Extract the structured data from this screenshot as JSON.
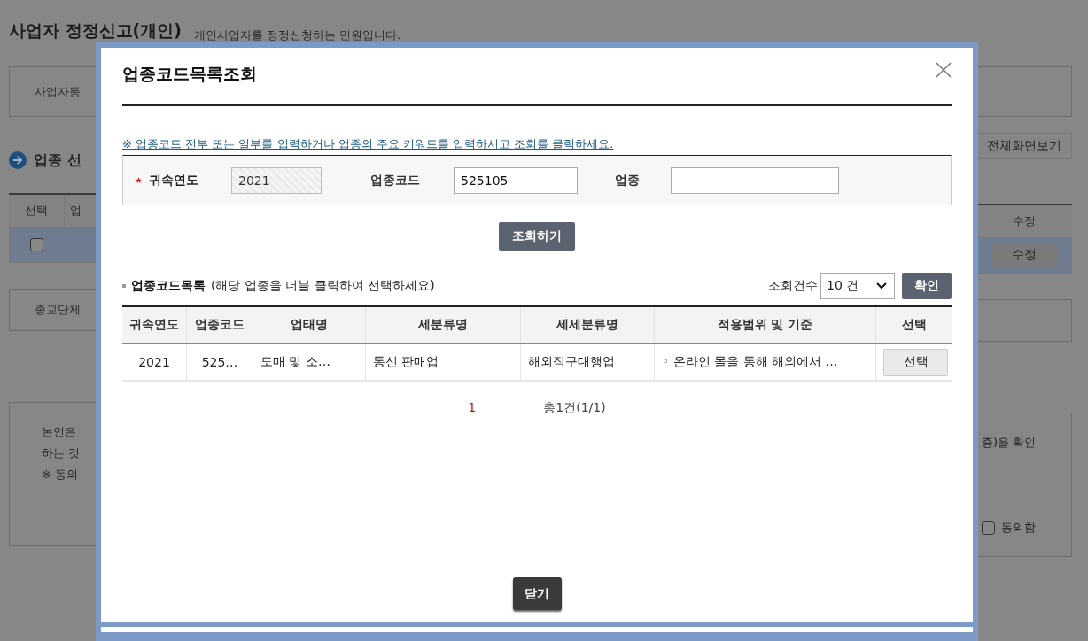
{
  "page": {
    "title": "사업자 정정신고(개인)",
    "subtitle": "개인사업자를 정정신청하는 민원입니다.",
    "left": {
      "box_label": "사업자등",
      "section_title": "업종 선",
      "table_headers": [
        "선택",
        "업"
      ],
      "row_checkbox": {
        "checked": false
      },
      "box2_label": "종교단체",
      "notice_lines": [
        "본인은",
        "하는 것",
        "※  동의"
      ]
    },
    "right": {
      "fullscreen_button": "전체화면보기",
      "table_header": "수정",
      "edit_button": "수정",
      "notice_text": "증)을 확인",
      "agree": {
        "label": "동의함",
        "checked": false
      }
    }
  },
  "modal": {
    "title": "업종코드목록조회",
    "hint": "※ 업종코드 전부 또는 일부를 입력하거나 업종의 주요 키워드를 입력하시고 조회를 클릭하세요.",
    "fields": [
      {
        "label": "귀속연도",
        "required": true,
        "value": "2021",
        "disabled": true
      },
      {
        "label": "업종코드",
        "required": false,
        "value": "525105",
        "disabled": false
      },
      {
        "label": "업종",
        "required": false,
        "disabled": false
      }
    ],
    "search_button": "조회하기",
    "list_title": "업종코드목록",
    "list_hint": "(해당 업종을 더블 클릭하여 선택하세요)",
    "count_label": "조회건수",
    "count_select": "10 건",
    "confirm_button": "확인",
    "table": {
      "columns": [
        "귀속연도",
        "업종코드",
        "업태명",
        "세분류명",
        "세세분류명",
        "적용범위 및 기준",
        "선택"
      ],
      "rows": [
        {
          "cells": [
            "2021",
            "525…",
            "도매 및 소…",
            "통신 판매업",
            "해외직구대행업",
            "◦ 온라인 몰을 통해 해외에서 …"
          ],
          "button": "선택"
        }
      ]
    },
    "pages": [
      {
        "label": "1",
        "selected": true
      }
    ],
    "total": "총1건(1/1)",
    "close_button": "닫기"
  }
}
